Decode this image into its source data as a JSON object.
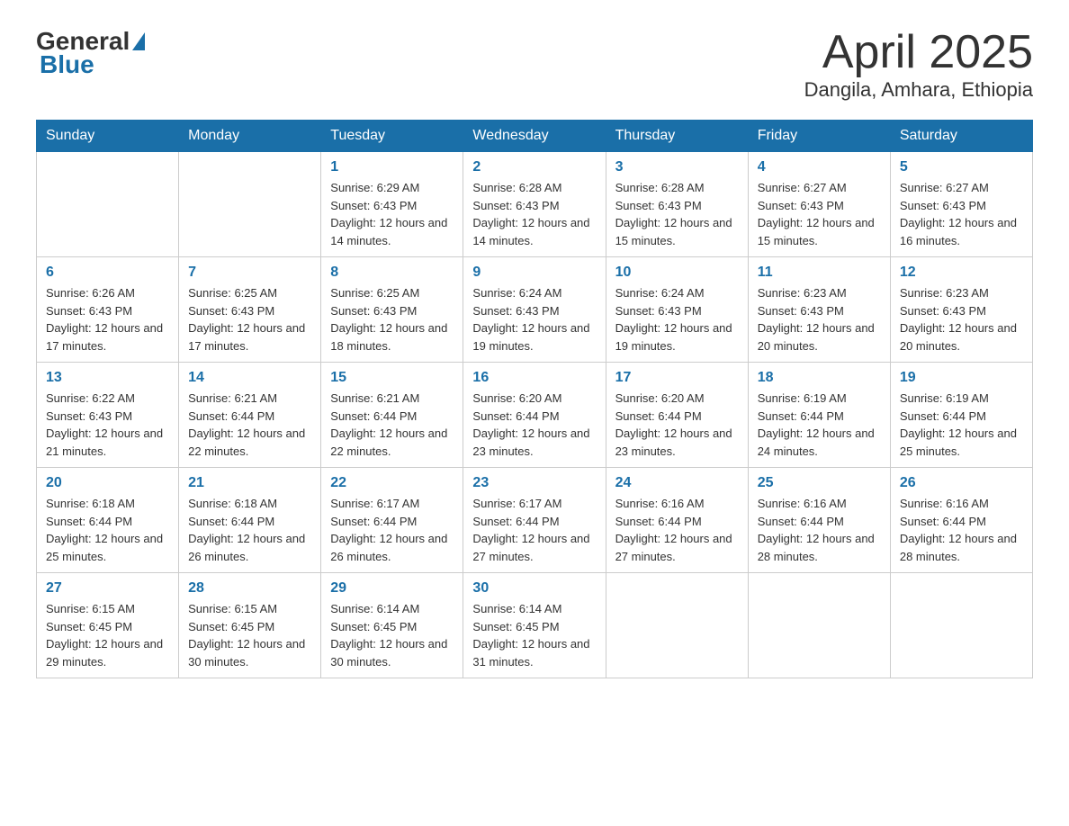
{
  "header": {
    "logo_general": "General",
    "logo_blue": "Blue",
    "title": "April 2025",
    "location": "Dangila, Amhara, Ethiopia"
  },
  "days_of_week": [
    "Sunday",
    "Monday",
    "Tuesday",
    "Wednesday",
    "Thursday",
    "Friday",
    "Saturday"
  ],
  "weeks": [
    [
      {
        "day": "",
        "info": ""
      },
      {
        "day": "",
        "info": ""
      },
      {
        "day": "1",
        "info": "Sunrise: 6:29 AM\nSunset: 6:43 PM\nDaylight: 12 hours and 14 minutes."
      },
      {
        "day": "2",
        "info": "Sunrise: 6:28 AM\nSunset: 6:43 PM\nDaylight: 12 hours and 14 minutes."
      },
      {
        "day": "3",
        "info": "Sunrise: 6:28 AM\nSunset: 6:43 PM\nDaylight: 12 hours and 15 minutes."
      },
      {
        "day": "4",
        "info": "Sunrise: 6:27 AM\nSunset: 6:43 PM\nDaylight: 12 hours and 15 minutes."
      },
      {
        "day": "5",
        "info": "Sunrise: 6:27 AM\nSunset: 6:43 PM\nDaylight: 12 hours and 16 minutes."
      }
    ],
    [
      {
        "day": "6",
        "info": "Sunrise: 6:26 AM\nSunset: 6:43 PM\nDaylight: 12 hours and 17 minutes."
      },
      {
        "day": "7",
        "info": "Sunrise: 6:25 AM\nSunset: 6:43 PM\nDaylight: 12 hours and 17 minutes."
      },
      {
        "day": "8",
        "info": "Sunrise: 6:25 AM\nSunset: 6:43 PM\nDaylight: 12 hours and 18 minutes."
      },
      {
        "day": "9",
        "info": "Sunrise: 6:24 AM\nSunset: 6:43 PM\nDaylight: 12 hours and 19 minutes."
      },
      {
        "day": "10",
        "info": "Sunrise: 6:24 AM\nSunset: 6:43 PM\nDaylight: 12 hours and 19 minutes."
      },
      {
        "day": "11",
        "info": "Sunrise: 6:23 AM\nSunset: 6:43 PM\nDaylight: 12 hours and 20 minutes."
      },
      {
        "day": "12",
        "info": "Sunrise: 6:23 AM\nSunset: 6:43 PM\nDaylight: 12 hours and 20 minutes."
      }
    ],
    [
      {
        "day": "13",
        "info": "Sunrise: 6:22 AM\nSunset: 6:43 PM\nDaylight: 12 hours and 21 minutes."
      },
      {
        "day": "14",
        "info": "Sunrise: 6:21 AM\nSunset: 6:44 PM\nDaylight: 12 hours and 22 minutes."
      },
      {
        "day": "15",
        "info": "Sunrise: 6:21 AM\nSunset: 6:44 PM\nDaylight: 12 hours and 22 minutes."
      },
      {
        "day": "16",
        "info": "Sunrise: 6:20 AM\nSunset: 6:44 PM\nDaylight: 12 hours and 23 minutes."
      },
      {
        "day": "17",
        "info": "Sunrise: 6:20 AM\nSunset: 6:44 PM\nDaylight: 12 hours and 23 minutes."
      },
      {
        "day": "18",
        "info": "Sunrise: 6:19 AM\nSunset: 6:44 PM\nDaylight: 12 hours and 24 minutes."
      },
      {
        "day": "19",
        "info": "Sunrise: 6:19 AM\nSunset: 6:44 PM\nDaylight: 12 hours and 25 minutes."
      }
    ],
    [
      {
        "day": "20",
        "info": "Sunrise: 6:18 AM\nSunset: 6:44 PM\nDaylight: 12 hours and 25 minutes."
      },
      {
        "day": "21",
        "info": "Sunrise: 6:18 AM\nSunset: 6:44 PM\nDaylight: 12 hours and 26 minutes."
      },
      {
        "day": "22",
        "info": "Sunrise: 6:17 AM\nSunset: 6:44 PM\nDaylight: 12 hours and 26 minutes."
      },
      {
        "day": "23",
        "info": "Sunrise: 6:17 AM\nSunset: 6:44 PM\nDaylight: 12 hours and 27 minutes."
      },
      {
        "day": "24",
        "info": "Sunrise: 6:16 AM\nSunset: 6:44 PM\nDaylight: 12 hours and 27 minutes."
      },
      {
        "day": "25",
        "info": "Sunrise: 6:16 AM\nSunset: 6:44 PM\nDaylight: 12 hours and 28 minutes."
      },
      {
        "day": "26",
        "info": "Sunrise: 6:16 AM\nSunset: 6:44 PM\nDaylight: 12 hours and 28 minutes."
      }
    ],
    [
      {
        "day": "27",
        "info": "Sunrise: 6:15 AM\nSunset: 6:45 PM\nDaylight: 12 hours and 29 minutes."
      },
      {
        "day": "28",
        "info": "Sunrise: 6:15 AM\nSunset: 6:45 PM\nDaylight: 12 hours and 30 minutes."
      },
      {
        "day": "29",
        "info": "Sunrise: 6:14 AM\nSunset: 6:45 PM\nDaylight: 12 hours and 30 minutes."
      },
      {
        "day": "30",
        "info": "Sunrise: 6:14 AM\nSunset: 6:45 PM\nDaylight: 12 hours and 31 minutes."
      },
      {
        "day": "",
        "info": ""
      },
      {
        "day": "",
        "info": ""
      },
      {
        "day": "",
        "info": ""
      }
    ]
  ]
}
